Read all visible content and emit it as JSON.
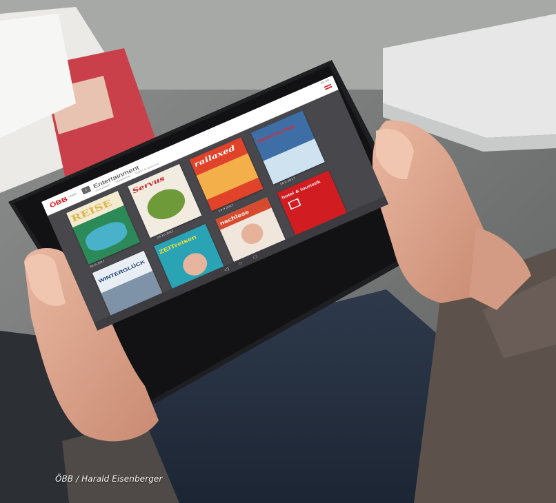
{
  "photo_credit": "ÖBB / Harald Eisenberger",
  "app": {
    "logo": "ÖBB",
    "logo_sub": "railjet",
    "back_icon": "chevron-left-icon",
    "title": "Entertainment",
    "tabs": [
      "Zeitungen",
      "Magazine",
      "Wein & Genuss"
    ],
    "status": "15:29"
  },
  "covers": [
    {
      "title": "REISE",
      "date": "30.6.2017",
      "color": "#2b8a57"
    },
    {
      "title": "Servus",
      "date": "24.10.2017",
      "color": "#f2ece0"
    },
    {
      "title": "railaxed",
      "date": "13.9.2017",
      "color": "#e1422a"
    },
    {
      "title": "BahnCity-Hits",
      "date": "18.9.2017",
      "color": "#3d6fa6"
    },
    {
      "title": "WINTERGLÜCK",
      "date": "",
      "color": "#e9eef4"
    },
    {
      "title": "ZEITreisen",
      "date": "",
      "color": "#2aa4b5"
    },
    {
      "title": "nachlese",
      "date": "",
      "color": "#d84a2e"
    },
    {
      "title": "hotel & touristik",
      "date": "",
      "color": "#d11d22"
    }
  ],
  "colors": {
    "brand": "#d7141a",
    "screen_bg": "#47474c"
  }
}
